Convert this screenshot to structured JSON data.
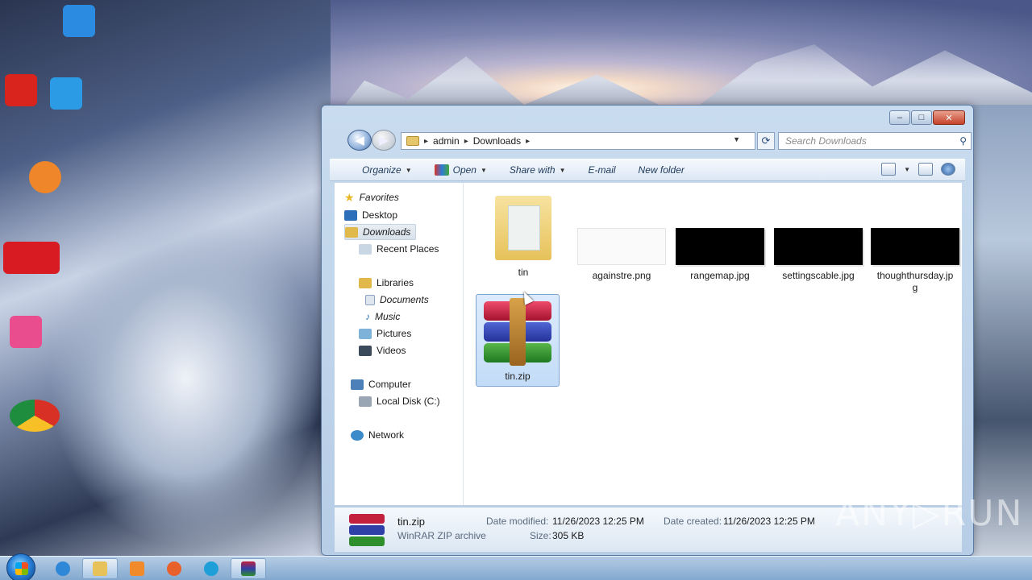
{
  "window": {
    "caption_buttons": {
      "minimize": "–",
      "maximize": "□",
      "close": "✕"
    }
  },
  "address_bar": {
    "path": [
      "admin",
      "Downloads"
    ],
    "separator": "▸",
    "search_placeholder": "Search Downloads"
  },
  "toolbar": {
    "organize": "Organize",
    "open": "Open",
    "share_with": "Share with",
    "email": "E-mail",
    "new_folder": "New folder"
  },
  "nav_pane": {
    "favorites": "Favorites",
    "desktop": "Desktop",
    "downloads": "Downloads",
    "recent_places": "Recent Places",
    "libraries": "Libraries",
    "documents": "Documents",
    "music": "Music",
    "pictures": "Pictures",
    "videos": "Videos",
    "computer": "Computer",
    "local_disk": "Local Disk (C:)",
    "network": "Network"
  },
  "files": [
    {
      "name": "tin",
      "kind": "folder"
    },
    {
      "name": "againstre.png",
      "kind": "image-white"
    },
    {
      "name": "rangemap.jpg",
      "kind": "image-black"
    },
    {
      "name": "settingscable.jpg",
      "kind": "image-black"
    },
    {
      "name": "thoughthursday.jpg",
      "kind": "image-black"
    },
    {
      "name": "tin.zip",
      "kind": "winrar-archive",
      "selected": true
    }
  ],
  "details": {
    "file_name": "tin.zip",
    "file_type": "WinRAR ZIP archive",
    "date_modified_label": "Date modified:",
    "date_modified": "11/26/2023 12:25 PM",
    "date_created_label": "Date created:",
    "date_created": "11/26/2023 12:25 PM",
    "size_label": "Size:",
    "size": "305 KB"
  },
  "watermark": "ANY▷RUN",
  "colors": {
    "selection": "#c3dcf7",
    "accent": "#2a4d7c"
  }
}
